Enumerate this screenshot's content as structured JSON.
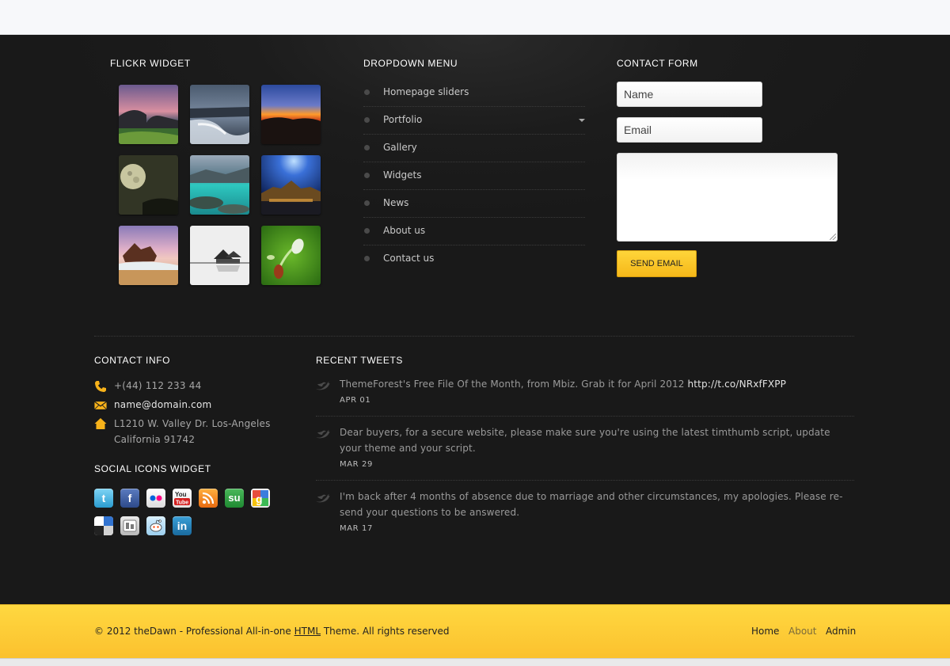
{
  "widgets": {
    "flickr_title": "FLICKR WIDGET",
    "menu_title": "DROPDOWN MENU",
    "form_title": "CONTACT FORM",
    "contact_info_title": "CONTACT INFO",
    "social_title": "SOCIAL ICONS WIDGET",
    "tweets_title": "RECENT TWEETS"
  },
  "flickr": {
    "images": [
      "sea-arch-sunset",
      "waves-rocks",
      "sunset-hills",
      "full-moon",
      "turquoise-lake",
      "temple-night",
      "shipwreck-beach",
      "misty-pier-hut",
      "green-flower-macro"
    ]
  },
  "menu": {
    "items": [
      {
        "label": "Homepage sliders"
      },
      {
        "label": "Portfolio"
      },
      {
        "label": "Gallery"
      },
      {
        "label": "Widgets"
      },
      {
        "label": "News"
      },
      {
        "label": "About us"
      },
      {
        "label": "Contact us"
      }
    ]
  },
  "form": {
    "name_placeholder": "Name",
    "email_placeholder": "Email",
    "message_value": "",
    "send_label": "SEND EMAIL"
  },
  "contact_info": {
    "phone": "+(44) 112 233 44",
    "email": "name@domain.com",
    "address_line1": "L1210 W. Valley Dr. Los-Angeles",
    "address_line2": "California 91742"
  },
  "social": {
    "icons": [
      "twitter-icon",
      "facebook-icon",
      "flickr-icon",
      "youtube-icon",
      "rss-icon",
      "stumbleupon-icon",
      "google-icon",
      "delicious-icon",
      "digg-icon",
      "reddit-icon",
      "linkedin-icon"
    ]
  },
  "tweets": [
    {
      "text": "ThemeForest's Free File Of the Month, from Mbiz. Grab it for April 2012 ",
      "link": "http://t.co/NRxfFXPP",
      "date": "APR 01"
    },
    {
      "text": "Dear buyers, for a secure website, please make sure you're using the latest timthumb script, update your theme and your script.",
      "date": "MAR 29"
    },
    {
      "text": "I'm back after 4 months of absence due to marriage and other circumstances, my apologies. Please re-send your questions to be answered.",
      "date": "MAR 17"
    }
  ],
  "bottom": {
    "copyright_pre": "© 2012 theDawn - Professional All-in-one ",
    "copyright_link": "HTML",
    "copyright_post": " Theme. All rights reserved",
    "nav": [
      "Home",
      "About",
      "Admin"
    ]
  },
  "colors": {
    "accent": "#fcc52f",
    "footer_bg": "#1c1c1c",
    "icon_orange": "#f7b21a"
  }
}
